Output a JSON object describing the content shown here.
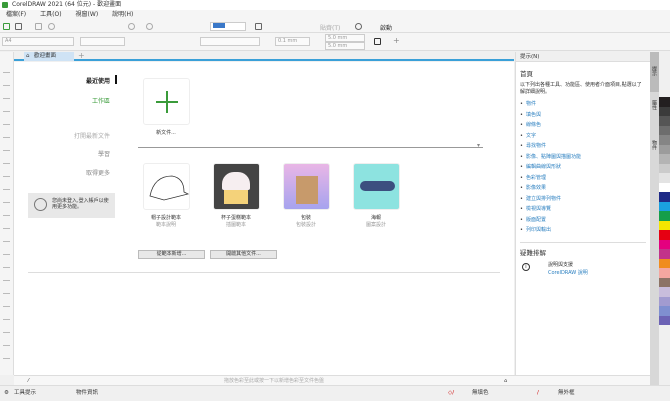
{
  "title": "CorelDRAW 2021 (64 位元) - 歡迎畫面",
  "menu": [
    "檔案(F)",
    "工具(O)",
    "視窗(W)",
    "說明(H)"
  ],
  "toolbar": {
    "snap_label": "貼齊(T)",
    "launch_label": "啟動",
    "paper": "A4",
    "nudge": "0.1 mm",
    "dup_x": "5.0 mm",
    "dup_y": "5.0 mm"
  },
  "tab": {
    "label": "歡迎畫面"
  },
  "nav": {
    "items": [
      "最近使用",
      "工作區",
      "打開最新文件",
      "學習",
      "取得更多"
    ],
    "active": 0,
    "promo": "您尚未登入,登入帳戶以使用更多功能。"
  },
  "new_doc": {
    "label": "新文件..."
  },
  "templates": [
    {
      "title": "帽子設計範本",
      "sub": "範本說明"
    },
    {
      "title": "杯子蛋糕範本",
      "sub": "插圖範本"
    },
    {
      "title": "包裝",
      "sub": "包裝設計"
    },
    {
      "title": "海報",
      "sub": "圖案設計"
    }
  ],
  "buttons": {
    "new_from_template": "從範本新增...",
    "open_other": "開啟其他文件..."
  },
  "docker": {
    "header": "提示(N)",
    "home": "首頁",
    "desc": "以下列出各種工具、功能區、使用者介面項目,點選以了解詳細說明。",
    "links": [
      "物件",
      "填色與",
      "線條色",
      "文字",
      "尋找物件",
      "影像、點陣圖與描圖功能",
      "編輯曲線與形狀",
      "色彩管理",
      "影像效果",
      "建立與排列物件",
      "檢視與導覽",
      "版面配置",
      "列印與輸出"
    ],
    "troubleshoot": "疑難排解",
    "info_title": "說明與支援",
    "info_link": "CorelDRAW 說明"
  },
  "vtabs": [
    "提示",
    "屬性",
    "物件"
  ],
  "palette": [
    "#231f20",
    "#3b3b3b",
    "#555555",
    "#6d6d6d",
    "#858585",
    "#9c9c9c",
    "#b4b4b4",
    "#cbcbcb",
    "#e3e3e3",
    "#ffffff",
    "#1e2a87",
    "#1aa0e0",
    "#159e4a",
    "#f5e600",
    "#e60012",
    "#e4007f",
    "#c2338a",
    "#f08c1e",
    "#f4a7a0",
    "#8c7366",
    "#c9bddc",
    "#a29bd0",
    "#7f8fd0",
    "#6c63b5"
  ],
  "docpal_hint": "拖放色彩至此或按一下以新增色彩至文件色盤",
  "status": {
    "tool_hint": "工具提示",
    "object_info": "物件資訊",
    "fill": "無填色",
    "outline": "無外框"
  },
  "colors": {
    "accent": "#3aa0d8",
    "green": "#3a9b3a"
  }
}
